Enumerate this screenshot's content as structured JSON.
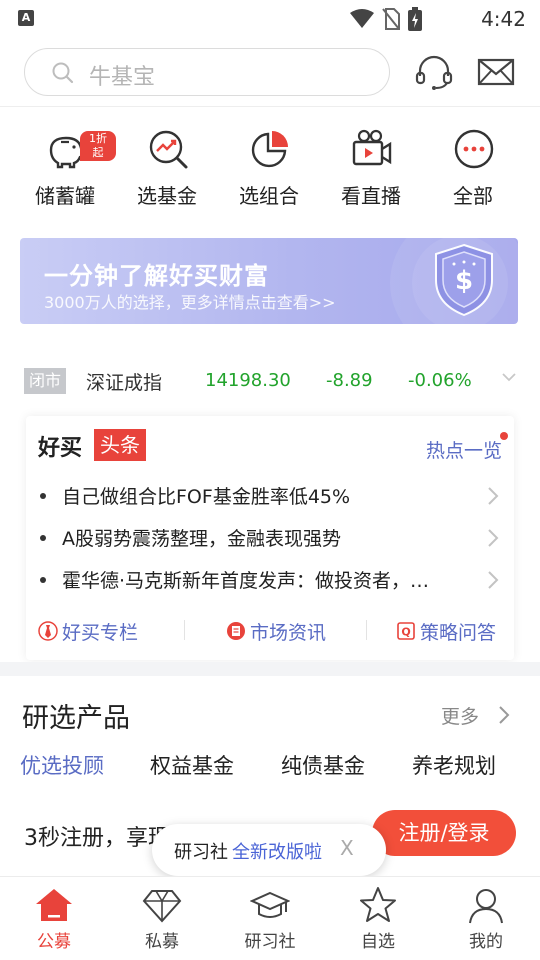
{
  "status_bar": {
    "app_badge": "A",
    "time": "4:42",
    "icons": [
      "wifi-icon",
      "no-sim-icon",
      "battery-charging-icon"
    ]
  },
  "header": {
    "search_placeholder": "牛基宝",
    "icons": [
      "customer-service-icon",
      "mail-icon"
    ]
  },
  "quick_menu": [
    {
      "label": "储蓄罐",
      "icon": "piggy-bank-icon",
      "tag": "1折起"
    },
    {
      "label": "选基金",
      "icon": "search-trend-icon"
    },
    {
      "label": "选组合",
      "icon": "pie-chart-icon"
    },
    {
      "label": "看直播",
      "icon": "video-camera-icon"
    },
    {
      "label": "全部",
      "icon": "more-dots-icon"
    }
  ],
  "banner": {
    "title": "一分钟了解好买财富",
    "subtitle": "3000万人的选择，更多详情点击查看>>",
    "icon": "dollar-shield-icon"
  },
  "ticker": {
    "status": "闭市",
    "index_name": "深证成指",
    "value": "14198.30",
    "change": "-8.89",
    "change_pct": "-0.06%",
    "change_color": "#22a32c"
  },
  "news": {
    "logo_left": "好买",
    "logo_right": "头条",
    "hot_link": "热点一览",
    "items": [
      {
        "text": "自己做组合比FOF基金胜率低45%"
      },
      {
        "text": "A股弱势震荡整理，金融表现强势"
      },
      {
        "text": "霍华德·马克斯新年首度发声：做投资者，…"
      }
    ],
    "tabs": [
      {
        "label": "好买专栏",
        "icon": "tie-icon"
      },
      {
        "label": "市场资讯",
        "icon": "news-doc-icon"
      },
      {
        "label": "策略问答",
        "icon": "q-icon"
      }
    ]
  },
  "products": {
    "title": "研选产品",
    "more": "更多",
    "tabs": [
      {
        "label": "优选投顾",
        "active": true
      },
      {
        "label": "权益基金",
        "active": false
      },
      {
        "label": "纯债基金",
        "active": false
      },
      {
        "label": "养老规划",
        "active": false
      }
    ]
  },
  "register": {
    "text": "3秒注册，享理",
    "button": "注册/登录"
  },
  "toast": {
    "prefix": "研习社",
    "highlight": "全新改版啦",
    "close": "X"
  },
  "bottom_nav": [
    {
      "label": "公募",
      "icon": "home-icon",
      "active": true
    },
    {
      "label": "私募",
      "icon": "diamond-icon",
      "active": false
    },
    {
      "label": "研习社",
      "icon": "graduation-cap-icon",
      "active": false
    },
    {
      "label": "自选",
      "icon": "star-icon",
      "active": false
    },
    {
      "label": "我的",
      "icon": "user-icon",
      "active": false
    }
  ],
  "colors": {
    "accent_blue": "#5a6cc4",
    "brand_red": "#e8433b",
    "register_orange": "#f24f3a",
    "up_down_green": "#22a32c"
  }
}
